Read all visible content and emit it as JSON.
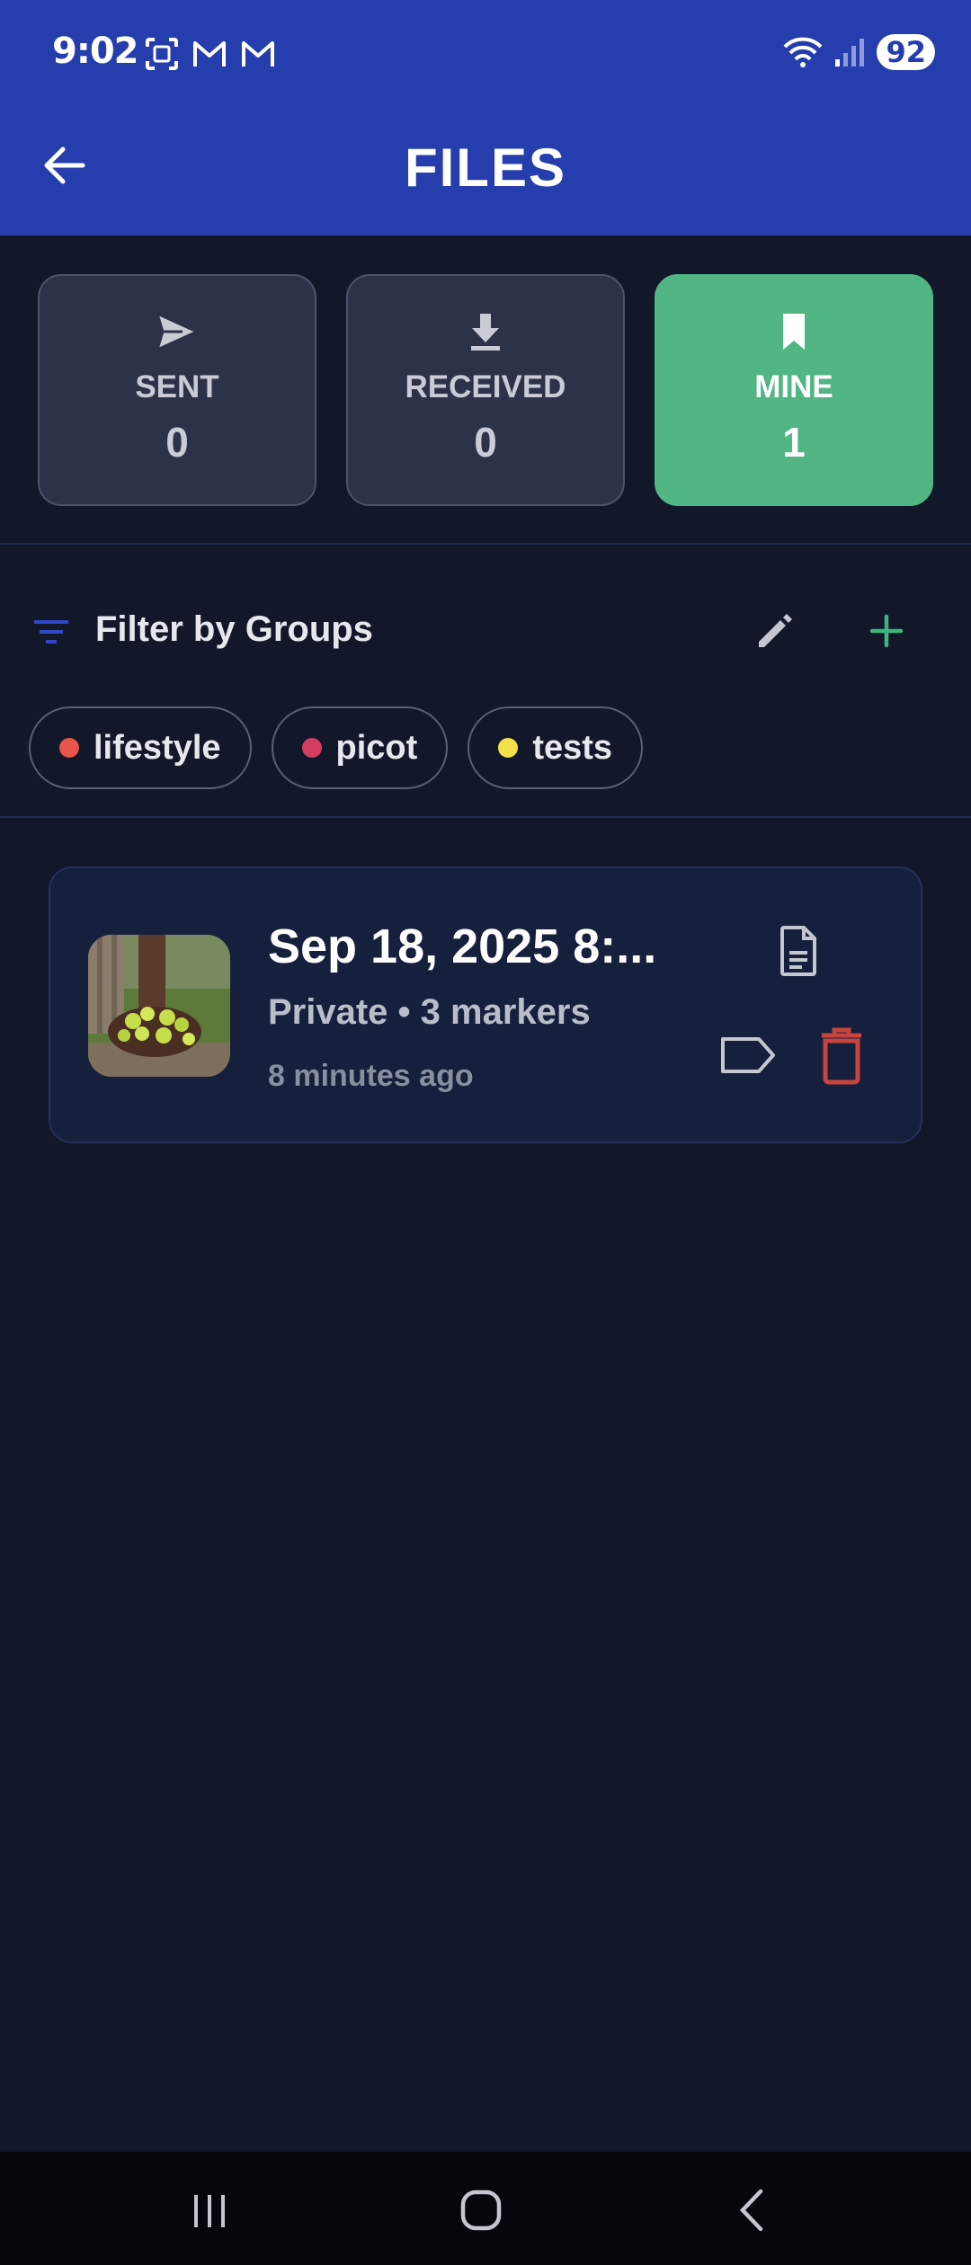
{
  "status_bar": {
    "time": "9:02",
    "battery": "92",
    "icons": [
      "screenshot-icon",
      "gmail-icon",
      "gmail-icon",
      "wifi-icon",
      "signal-icon"
    ]
  },
  "header": {
    "title": "FILES",
    "back_icon": "arrow-left-icon"
  },
  "stats": [
    {
      "label": "SENT",
      "count": "0",
      "icon": "send-icon",
      "active": false
    },
    {
      "label": "RECEIVED",
      "count": "0",
      "icon": "download-icon",
      "active": false
    },
    {
      "label": "MINE",
      "count": "1",
      "icon": "bookmark-icon",
      "active": true
    }
  ],
  "filter": {
    "label": "Filter by Groups",
    "groups": [
      {
        "name": "lifestyle",
        "color": "#e8554a"
      },
      {
        "name": "picot",
        "color": "#d63d62"
      },
      {
        "name": "tests",
        "color": "#f2e14a"
      }
    ]
  },
  "files": [
    {
      "title": "Sep 18, 2025 8:...",
      "subtitle": "Private • 3 markers",
      "time": "8 minutes ago"
    }
  ],
  "colors": {
    "header": "#263dae",
    "background": "#12172a",
    "active_card": "#52b584",
    "delete": "#c9443f",
    "add": "#3fb47a"
  }
}
